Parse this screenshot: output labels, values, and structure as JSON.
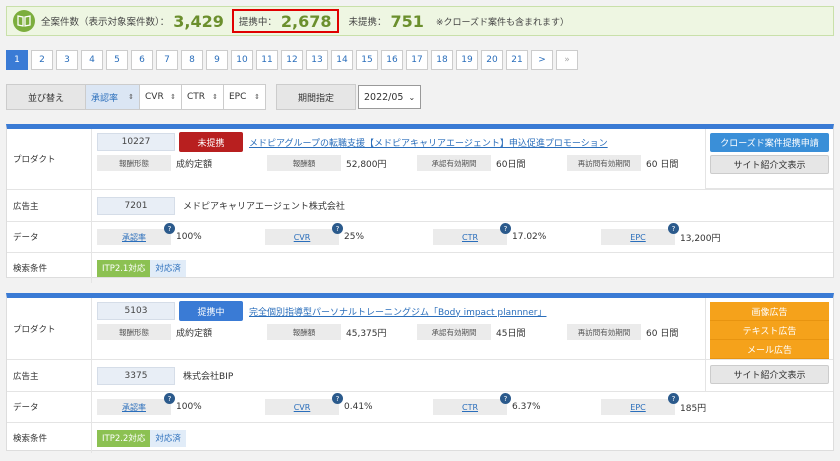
{
  "summary": {
    "total_label": "全案件数（表示対象案件数）：",
    "total_value": "3,429",
    "partnered_label": "提携中：",
    "partnered_value": "2,678",
    "unpartnered_label": "未提携：",
    "unpartnered_value": "751",
    "note": "※クローズド案件も含まれます）"
  },
  "pagination": {
    "pages": [
      "1",
      "2",
      "3",
      "4",
      "5",
      "6",
      "7",
      "8",
      "9",
      "10",
      "11",
      "12",
      "13",
      "14",
      "15",
      "16",
      "17",
      "18",
      "19",
      "20",
      "21"
    ],
    "next": ">",
    "last": "»"
  },
  "sort": {
    "label": "並び替え",
    "options": [
      "承認率",
      "CVR",
      "CTR",
      "EPC"
    ],
    "period_label": "期間指定",
    "period_value": "2022/05"
  },
  "labels": {
    "product": "プロダクト",
    "advertiser": "広告主",
    "data": "データ",
    "search": "検索条件",
    "reward_type": "報酬形態",
    "reward_amount": "報酬額",
    "approval_period": "承認有効期間",
    "revisit_period": "再訪問有効期間",
    "approval_rate": "承認率",
    "cvr": "CVR",
    "ctr": "CTR",
    "epc": "EPC",
    "qmark": "?"
  },
  "campaigns": [
    {
      "id": "10227",
      "status": "未提携",
      "title": "メドピアグループの転職支援【メドピアキャリアエージェント】申込促進プロモーション",
      "reward_type": "成約定額",
      "reward_amount": "52,800円",
      "approval_period": "60日間",
      "revisit_period": "60 日間",
      "advertiser_id": "7201",
      "advertiser_name": "メドピアキャリアエージェント株式会社",
      "approval_rate": "100%",
      "cvr": "25%",
      "ctr": "17.02%",
      "epc": "13,200円",
      "tags": [
        "ITP2.1対応",
        "対応済"
      ],
      "buttons": [
        "クローズド案件提携申請",
        "サイト紹介文表示"
      ]
    },
    {
      "id": "5103",
      "status": "提携中",
      "title": "完全個別指導型パーソナルトレーニングジム「Body impact plannner」",
      "reward_type": "成約定額",
      "reward_amount": "45,375円",
      "approval_period": "45日間",
      "revisit_period": "60 日間",
      "advertiser_id": "3375",
      "advertiser_name": "株式会社BIP",
      "approval_rate": "100%",
      "cvr": "0.41%",
      "ctr": "6.37%",
      "epc": "185円",
      "tags": [
        "ITP2.2対応",
        "対応済"
      ],
      "buttons": [
        "画像広告",
        "テキスト広告",
        "メール広告",
        "サイト紹介文表示"
      ]
    }
  ]
}
